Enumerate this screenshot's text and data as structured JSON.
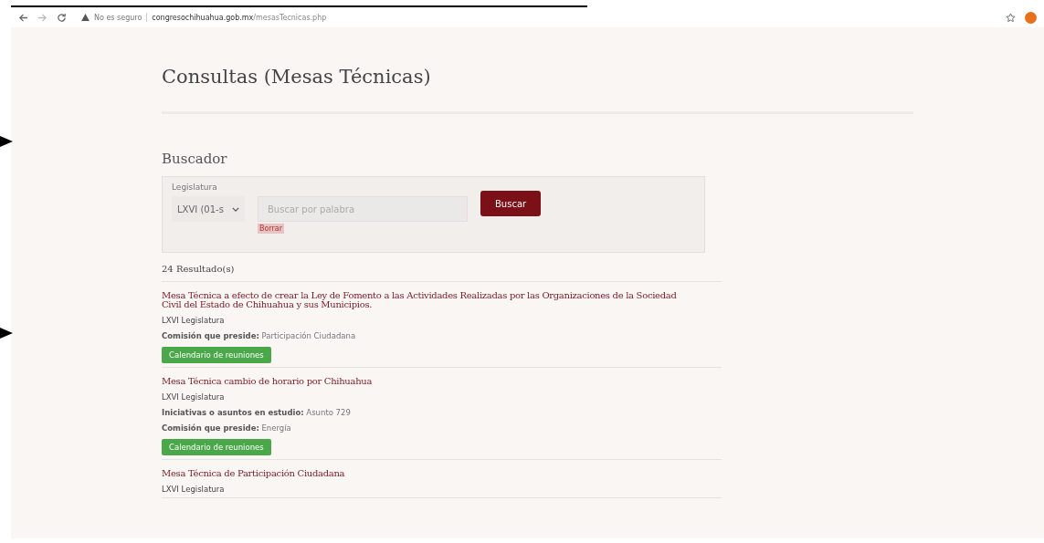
{
  "browser": {
    "security": "No es seguro",
    "url_domain": "congresochihuahua.gob.mx",
    "url_path": "/mesasTecnicas.php"
  },
  "page": {
    "title": "Consultas (Mesas Técnicas)"
  },
  "search": {
    "heading": "Buscador",
    "legislatura_label": "Legislatura",
    "legislatura_value": "LXVI (01-s",
    "placeholder": "Buscar por palabra",
    "clear_label": "Borrar",
    "button": "Buscar"
  },
  "results_count": "24 Resultado(s)",
  "results": [
    {
      "title": "Mesa Técnica a efecto de crear la Ley de Fomento a las Actividades Realizadas por las Organizaciones de la Sociedad Civil del Estado de Chihuahua y sus Municipios.",
      "legislatura": "LXVI Legislatura",
      "fields": [
        {
          "label": "Comisión que preside:",
          "value": "Participación Ciudadana"
        }
      ],
      "button": "Calendario de reuniones"
    },
    {
      "title": "Mesa Técnica cambio de horario por Chihuahua",
      "legislatura": "LXVI Legislatura",
      "fields": [
        {
          "label": "Iniciativas o asuntos en estudio:",
          "value": "Asunto 729"
        },
        {
          "label": "Comisión que preside:",
          "value": "Energía"
        }
      ],
      "button": "Calendario de reuniones"
    },
    {
      "title": "Mesa Técnica de Participación Ciudadana",
      "legislatura": "LXVI Legislatura"
    }
  ]
}
